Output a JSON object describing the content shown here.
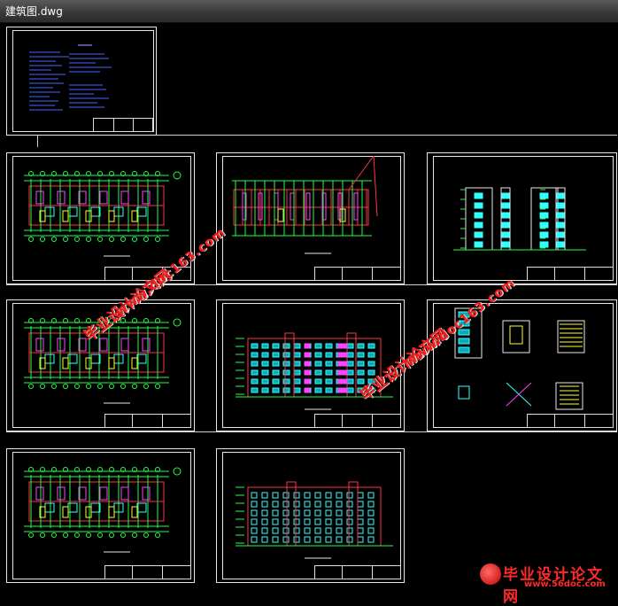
{
  "window": {
    "title": "建筑图.dwg"
  },
  "watermarks": [
    {
      "text": "毕业设计论文网",
      "kind": "cn"
    },
    {
      "text": "www.doc163.com",
      "kind": "url"
    },
    {
      "text": "毕业设计论文网",
      "kind": "cn"
    },
    {
      "text": "www.doc163.com",
      "kind": "url"
    }
  ],
  "logo": {
    "main": "毕业设计论文网",
    "url": "www.56doc.com"
  },
  "sheets": [
    {
      "id": "notes",
      "drawing": "notes"
    },
    {
      "id": "plan-1",
      "drawing": "plan"
    },
    {
      "id": "roof",
      "drawing": "roof"
    },
    {
      "id": "sections",
      "drawing": "sections"
    },
    {
      "id": "plan-2",
      "drawing": "plan"
    },
    {
      "id": "elev-front",
      "drawing": "elevation"
    },
    {
      "id": "details",
      "drawing": "details"
    },
    {
      "id": "plan-3",
      "drawing": "plan"
    },
    {
      "id": "elev-back",
      "drawing": "elevation"
    }
  ],
  "colors": {
    "line": "#e8e8e8",
    "green": "#22ff44",
    "red": "#ff3344",
    "cyan": "#33ffff",
    "magenta": "#ff44ff",
    "yellow": "#ffff33",
    "blue": "#4466ff"
  }
}
